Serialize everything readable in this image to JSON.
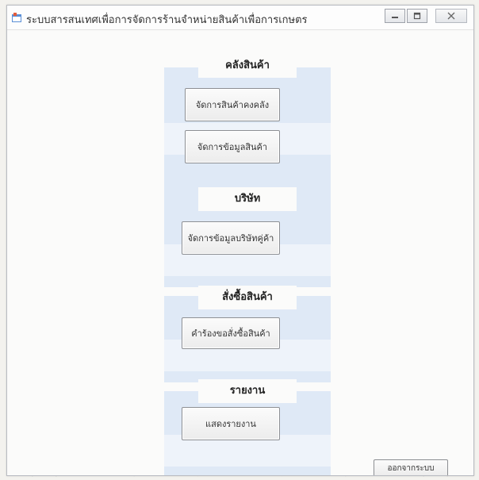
{
  "window": {
    "title": "ระบบสารสนเทศเพื่อการจัดการร้านจำหน่ายสินค้าเพื่อการเกษตร",
    "icon": "app-icon"
  },
  "sections": {
    "stock": {
      "heading": "คลังสินค้า",
      "buttons": [
        "จัดการสินค้าคงคลัง",
        "จัดการข้อมูลสินค้า"
      ]
    },
    "company": {
      "heading": "บริษัท",
      "buttons": [
        "จัดการข้อมูลบริษัทคู่ค้า"
      ]
    },
    "order": {
      "heading": "สั่งซื้อสินค้า",
      "buttons": [
        "คำร้องขอสั่งซื้อสินค้า"
      ]
    },
    "report": {
      "heading": "รายงาน",
      "buttons": [
        "แสดงรายงาน"
      ]
    }
  },
  "footer": {
    "exit_label": "ออกจากระบบ"
  },
  "colors": {
    "panel": "#dfe9f6",
    "window_bg": "#fbfbfa",
    "emblem_stroke": "#b9b9b9"
  }
}
